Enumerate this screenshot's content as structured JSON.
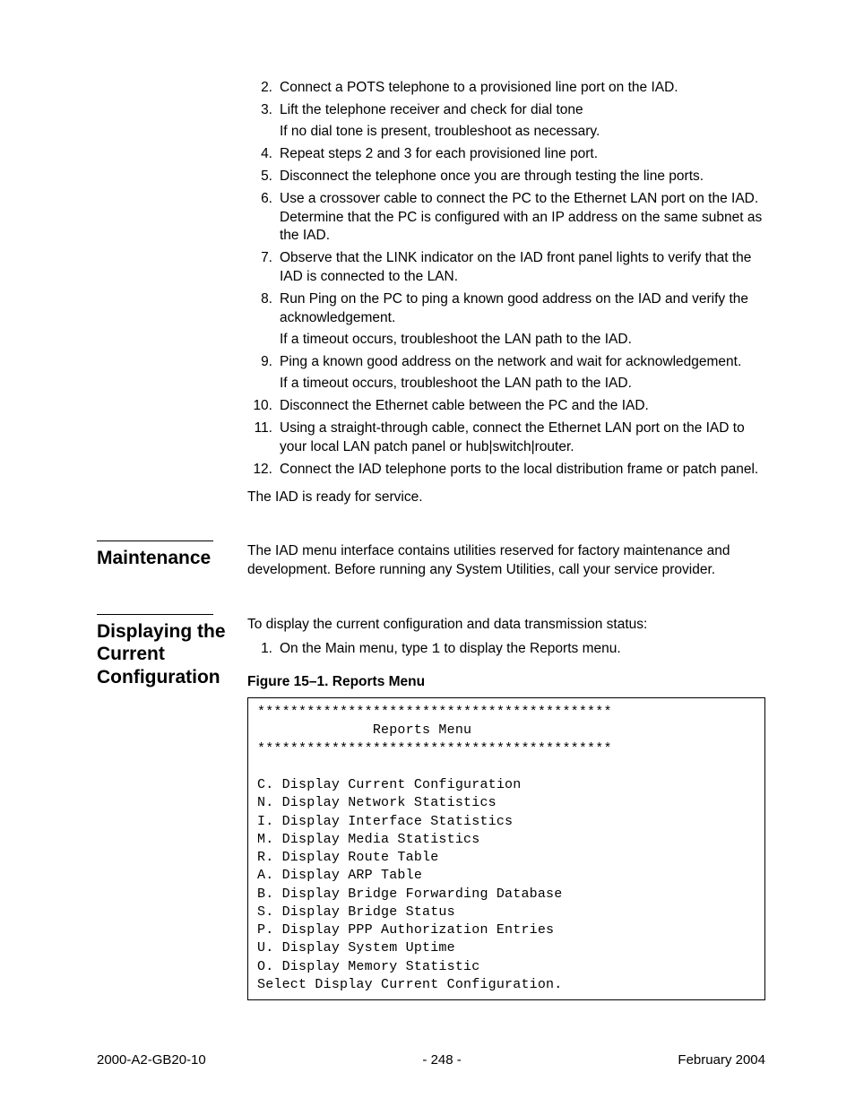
{
  "steps": [
    {
      "n": "2.",
      "lines": [
        "Connect a POTS telephone to a provisioned line port on the IAD."
      ]
    },
    {
      "n": "3.",
      "lines": [
        "Lift the telephone receiver and check for dial tone",
        "If no dial tone is present, troubleshoot as necessary."
      ]
    },
    {
      "n": "4.",
      "lines": [
        "Repeat steps 2 and 3 for each provisioned line port."
      ]
    },
    {
      "n": "5.",
      "lines": [
        "Disconnect the telephone once you are through testing the line ports."
      ]
    },
    {
      "n": "6.",
      "lines": [
        "Use a crossover cable to connect the PC to the Ethernet LAN port on the IAD. Determine that the PC is configured with an IP address on the same subnet as the IAD."
      ]
    },
    {
      "n": "7.",
      "lines": [
        "Observe that the LINK indicator on the IAD front panel lights to verify that the IAD is connected to the LAN."
      ]
    },
    {
      "n": "8.",
      "lines": [
        "Run Ping on the PC to ping a known good address on the IAD and verify the acknowledgement.",
        "If a timeout occurs, troubleshoot the LAN path to the IAD."
      ]
    },
    {
      "n": "9.",
      "lines": [
        "Ping a known good address on the network and wait for acknowledgement.",
        "If a timeout occurs, troubleshoot the LAN path to the IAD."
      ]
    },
    {
      "n": "10.",
      "lines": [
        "Disconnect the Ethernet cable between the PC and the IAD."
      ]
    },
    {
      "n": "11.",
      "lines": [
        "Using a straight-through cable, connect the Ethernet LAN port on the IAD to your local LAN patch panel or hub|switch|router."
      ]
    },
    {
      "n": "12.",
      "lines": [
        "Connect the IAD telephone ports to the local distribution frame or patch panel."
      ]
    }
  ],
  "closing": "The IAD is ready for service.",
  "sections": {
    "maint": {
      "heading": "Mainte­nance",
      "body": "The IAD menu interface contains utilities reserved for factory maintenance and development. Before running any System Utilities, call your service provider."
    },
    "display": {
      "heading": "Displaying the Current Configura­tion",
      "intro": "To display the current configuration and data transmission status:",
      "step_n": "1.",
      "step_pre": "On the Main menu, type ",
      "step_key": "1",
      "step_post": " to display the Reports menu.",
      "figcap": "Figure 15–1.  Reports Menu",
      "menu": "*******************************************\n              Reports Menu\n*******************************************\n\nC. Display Current Configuration\nN. Display Network Statistics\nI. Display Interface Statistics\nM. Display Media Statistics\nR. Display Route Table\nA. Display ARP Table\nB. Display Bridge Forwarding Database\nS. Display Bridge Status\nP. Display PPP Authorization Entries\nU. Display System Uptime\nO. Display Memory Statistic\nSelect Display Current Configuration."
    }
  },
  "footer": {
    "left": "2000-A2-GB20-10",
    "center": "- 248 -",
    "right": "February 2004"
  }
}
